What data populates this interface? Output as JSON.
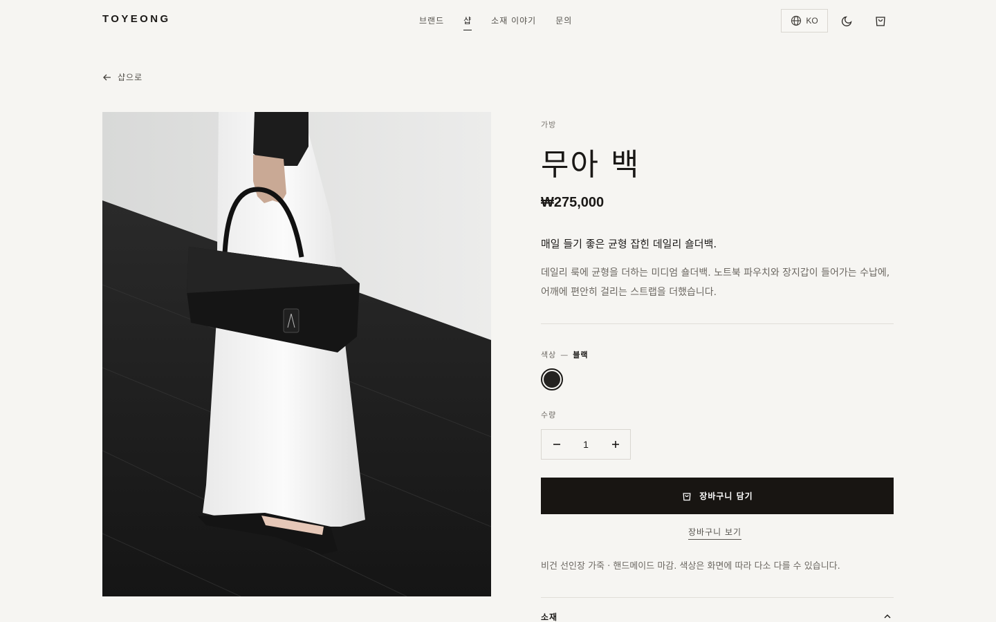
{
  "header": {
    "logo": "TOYEONG",
    "nav": [
      "브랜드",
      "샵",
      "소재 이야기",
      "문의"
    ],
    "active_nav": "샵",
    "lang": "KO",
    "icons": [
      "globe-icon",
      "moon-icon",
      "shopping-bag-icon"
    ]
  },
  "back_link": "샵으로",
  "product": {
    "category": "가방",
    "name": "무아 백",
    "price": "₩275,000",
    "tagline": "매일 들기 좋은 균형 잡힌 데일리 숄더백.",
    "description": "데일리 룩에 균형을 더하는 미디엄 숄더백. 노트북 파우치와 장지갑이 들어가는 수납에, 어깨에 편안히 걸리는 스트랩을 더했습니다.",
    "image_alt": "black shoulder bag held by model in white dress",
    "color_label": "색상",
    "color_sep": "—",
    "color_value": "블랙",
    "swatch_color": "#252321",
    "qty_label": "수량",
    "qty": "1",
    "add_to_cart": "장바구니 담기",
    "view_cart": "장바구니 보기",
    "note": "비건 선인장 가죽 · 핸드메이드 마감. 색상은 화면에 따라 다소 다를 수 있습니다.",
    "accordion": "소재"
  },
  "colors": {
    "background": "#f6f5f2",
    "text": "#1a1816",
    "button": "#181512"
  }
}
